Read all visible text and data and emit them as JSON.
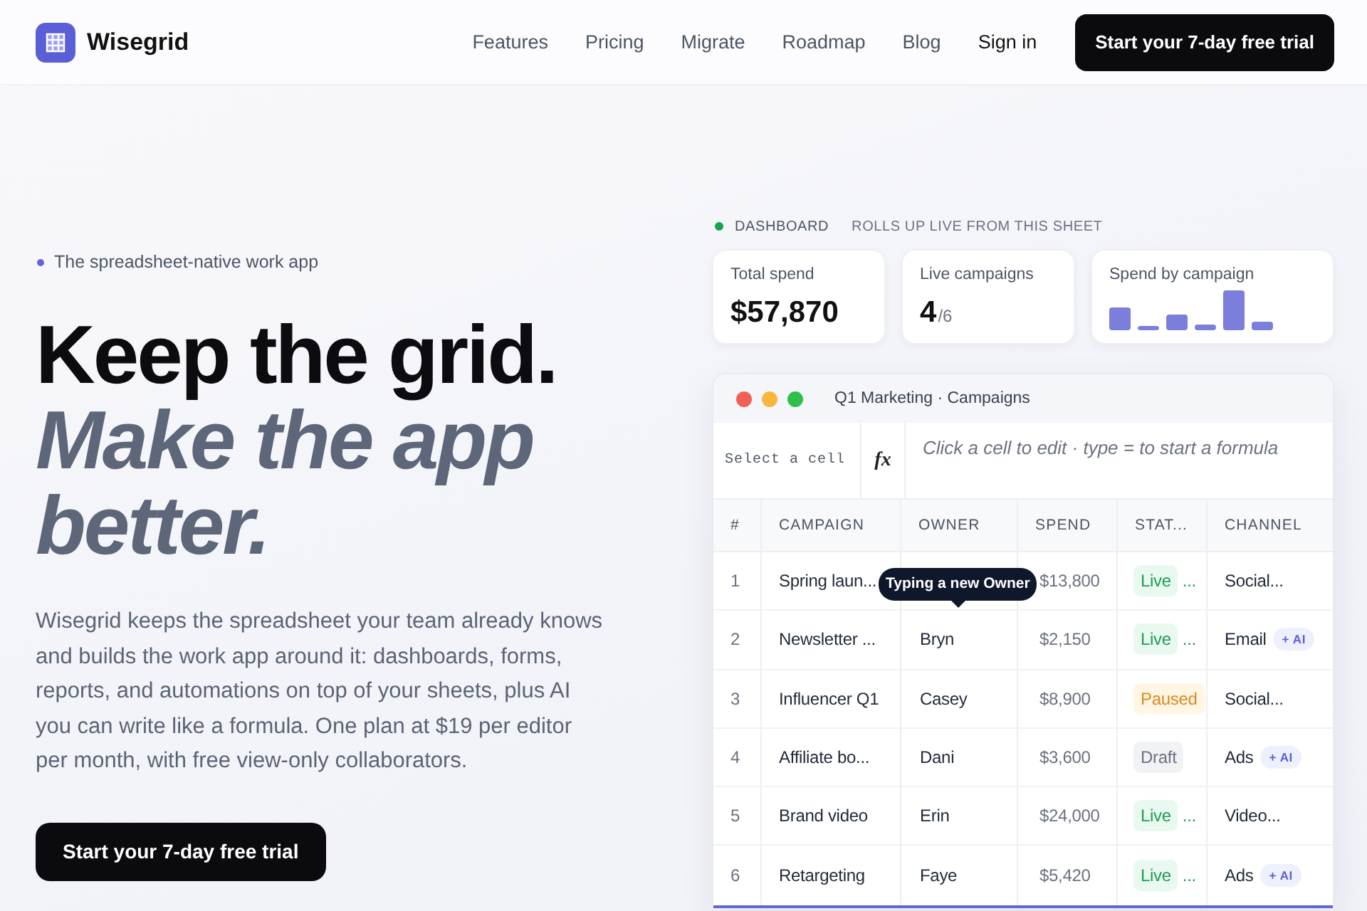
{
  "nav": {
    "brand": "Wisegrid",
    "links": [
      {
        "label": "Features"
      },
      {
        "label": "Pricing"
      },
      {
        "label": "Migrate"
      },
      {
        "label": "Roadmap"
      },
      {
        "label": "Blog"
      }
    ],
    "sign_in": "Sign in",
    "cta": "Start your 7-day free trial"
  },
  "hero": {
    "eyebrow": "The spreadsheet-native work app",
    "headline": "Keep the grid.",
    "headline_accent": "Make the app better.",
    "body": "Wisegrid keeps the spreadsheet your team already knows and builds the work app around it: dashboards, forms, reports, and automations on top of your sheets, plus AI you can write like a formula. One plan at $19 per editor per month, with free view-only collaborators.",
    "cta": "Start your 7-day free trial"
  },
  "dashboard": {
    "label": "DASHBOARD",
    "note": "ROLLS UP LIVE FROM THIS SHEET",
    "cards": [
      {
        "kind": "stat",
        "label": "Total spend",
        "value": "$57,870"
      },
      {
        "kind": "ratio",
        "label": "Live campaigns",
        "value": "4",
        "total": "/6"
      },
      {
        "kind": "bars",
        "label": "Spend by campaign"
      }
    ]
  },
  "sheet": {
    "title": "Q1 Marketing · Campaigns",
    "cell_box": {
      "placeholder": "Select a cell"
    },
    "formula_label": "fx",
    "formula_field": {
      "placeholder": "Click a cell to edit · type = to start a formula"
    },
    "columns": [
      "#",
      "CAMPAIGN",
      "OWNER",
      "SPEND",
      "STAT...",
      "CHANNEL"
    ],
    "rows": [
      {
        "number": "1",
        "campaign": "Spring laun...",
        "owner_tooltip": "Typing a new Owner",
        "spend": "$13,800",
        "status": {
          "kind": "live",
          "label": "Live",
          "more": "..."
        },
        "channel": "Social..."
      },
      {
        "number": "2",
        "campaign": "Newsletter ...",
        "owner": "Bryn",
        "spend": "$2,150",
        "status": {
          "kind": "live",
          "label": "Live",
          "more": "..."
        },
        "channel": "Email",
        "ai_tag": "+ AI"
      },
      {
        "number": "3",
        "campaign": "Influencer Q1",
        "owner": "Casey",
        "spend": "$8,900",
        "status": {
          "kind": "paused",
          "label": "Paused"
        },
        "channel": "Social..."
      },
      {
        "number": "4",
        "campaign": "Affiliate bo...",
        "owner": "Dani",
        "spend": "$3,600",
        "status": {
          "kind": "draft",
          "label": "Draft"
        },
        "channel": "Ads",
        "ai_tag": "+ AI"
      },
      {
        "number": "5",
        "campaign": "Brand video",
        "owner": "Erin",
        "spend": "$24,000",
        "status": {
          "kind": "live",
          "label": "Live",
          "more": "..."
        },
        "channel": "Video..."
      },
      {
        "number": "6",
        "campaign": "Retargeting",
        "owner": "Faye",
        "spend": "$5,420",
        "status": {
          "kind": "live",
          "label": "Live",
          "more": "..."
        },
        "channel": "Ads",
        "ai_tag": "+ AI"
      }
    ]
  }
}
